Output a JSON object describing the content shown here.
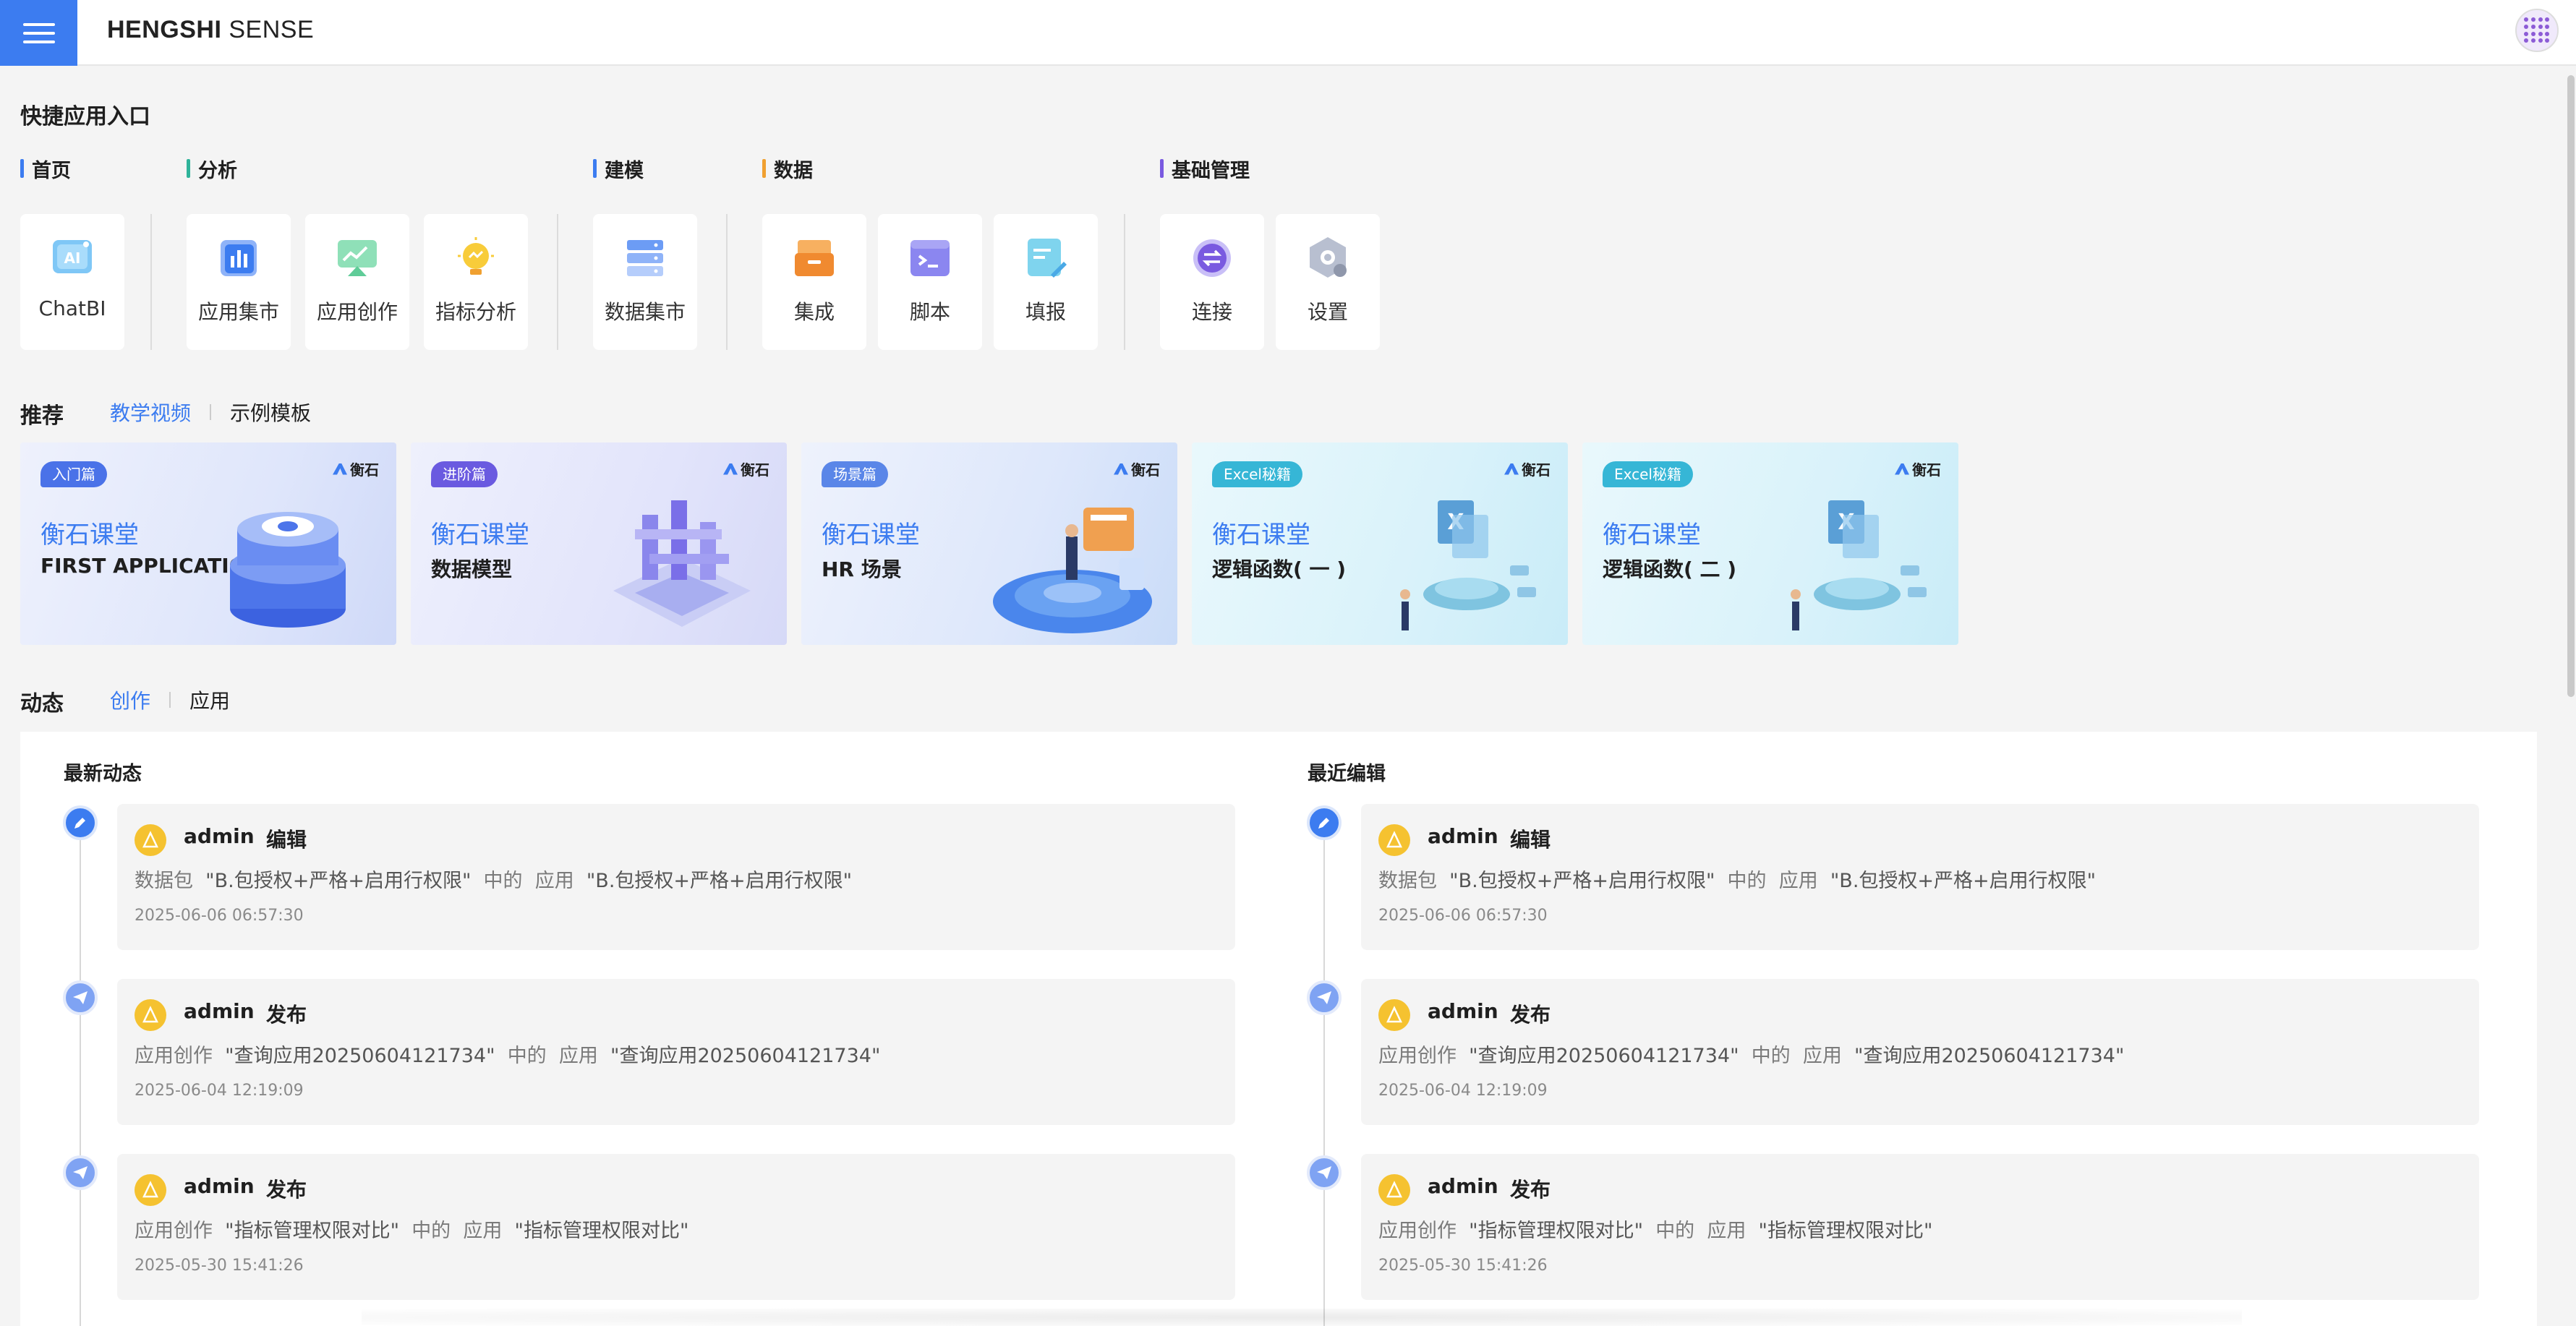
{
  "header": {
    "brand_bold": "HENGSHI",
    "brand_light": " SENSE"
  },
  "quick": {
    "title": "快捷应用入口",
    "groups": [
      {
        "label": "首页",
        "color": "#3c7cf0"
      },
      {
        "label": "分析",
        "color": "#2fb39a"
      },
      {
        "label": "建模",
        "color": "#3c7cf0"
      },
      {
        "label": "数据",
        "color": "#f0a030"
      },
      {
        "label": "基础管理",
        "color": "#7a5ae0"
      }
    ],
    "tiles": [
      {
        "label": "ChatBI",
        "icon": "ai-icon"
      },
      {
        "label": "应用集市",
        "icon": "app-market-icon"
      },
      {
        "label": "应用创作",
        "icon": "app-create-icon"
      },
      {
        "label": "指标分析",
        "icon": "metric-bulb-icon"
      },
      {
        "label": "数据集市",
        "icon": "data-market-icon"
      },
      {
        "label": "集成",
        "icon": "integration-icon"
      },
      {
        "label": "脚本",
        "icon": "script-icon"
      },
      {
        "label": "填报",
        "icon": "form-fill-icon"
      },
      {
        "label": "连接",
        "icon": "connection-icon"
      },
      {
        "label": "设置",
        "icon": "settings-icon"
      }
    ]
  },
  "recommend": {
    "title": "推荐",
    "tabs": [
      "教学视频",
      "示例模板"
    ],
    "cards": [
      {
        "badge": "入门篇",
        "logo": "衡石",
        "title": "衡石课堂",
        "sub": "FIRST APPLICATION"
      },
      {
        "badge": "进阶篇",
        "logo": "衡石",
        "title": "衡石课堂",
        "sub": "数据模型"
      },
      {
        "badge": "场景篇",
        "logo": "衡石",
        "title": "衡石课堂",
        "sub": "HR 场景"
      },
      {
        "badge": "Excel秘籍",
        "logo": "衡石",
        "title": "衡石课堂",
        "sub": "逻辑函数( 一 )"
      },
      {
        "badge": "Excel秘籍",
        "logo": "衡石",
        "title": "衡石课堂",
        "sub": "逻辑函数( 二 )"
      }
    ]
  },
  "activity": {
    "title": "动态",
    "tabs": [
      "创作",
      "应用"
    ],
    "left_title": "最新动态",
    "right_title": "最近编辑",
    "entries": [
      {
        "user": "admin",
        "action": "编辑",
        "p1": "数据包",
        "q1": "\"B.包授权+严格+启用行权限\"",
        "mid": "中的",
        "p2": "应用",
        "q2": "\"B.包授权+严格+启用行权限\"",
        "time": "2025-06-06 06:57:30"
      },
      {
        "user": "admin",
        "action": "发布",
        "p1": "应用创作",
        "q1": "\"查询应用20250604121734\"",
        "mid": "中的",
        "p2": "应用",
        "q2": "\"查询应用20250604121734\"",
        "time": "2025-06-04 12:19:09"
      },
      {
        "user": "admin",
        "action": "发布",
        "p1": "应用创作",
        "q1": "\"指标管理权限对比\"",
        "mid": "中的",
        "p2": "应用",
        "q2": "\"指标管理权限对比\"",
        "time": "2025-05-30 15:41:26"
      }
    ]
  }
}
